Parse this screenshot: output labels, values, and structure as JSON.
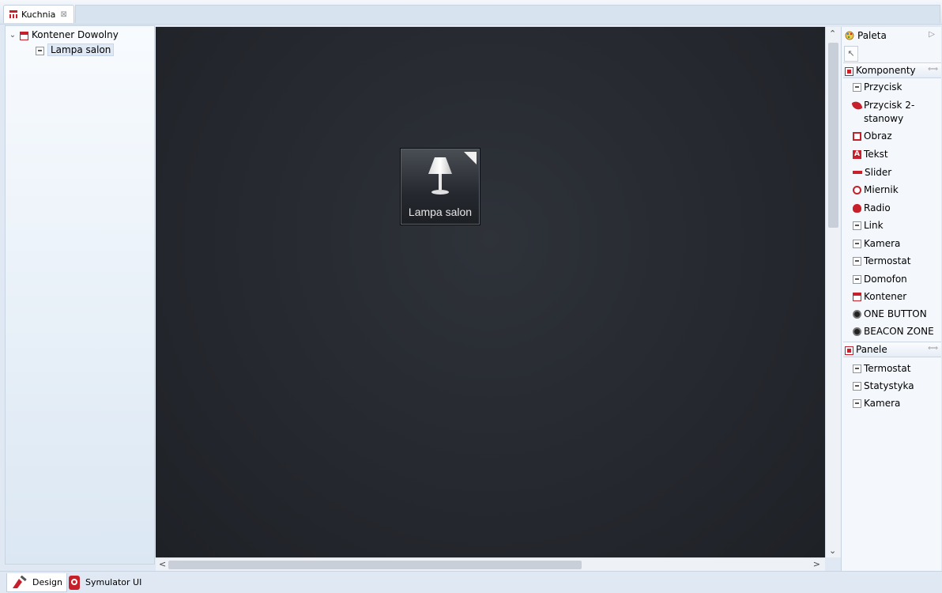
{
  "editor_tab": {
    "title": "Kuchnia",
    "close_glyph": "⊠",
    "icon": "layout-icon"
  },
  "outline": {
    "root": {
      "label": "Kontener Dowolny",
      "expanded": true,
      "icon": "container-icon"
    },
    "child": {
      "label": "Lampa salon",
      "icon": "component-icon"
    }
  },
  "canvas": {
    "widget": {
      "label": "Lampa salon",
      "icon": "lamp-icon"
    }
  },
  "palette": {
    "title": "Paleta",
    "drawers": [
      {
        "label": "Komponenty",
        "items": [
          {
            "label": "Przycisk",
            "icon": "default-icon"
          },
          {
            "label": "Przycisk 2-",
            "label2": "stanowy",
            "icon": "toggle-icon"
          },
          {
            "label": "Obraz",
            "icon": "image-icon"
          },
          {
            "label": "Tekst",
            "icon": "text-icon"
          },
          {
            "label": "Slider",
            "icon": "slider-icon"
          },
          {
            "label": "Miernik",
            "icon": "gauge-icon"
          },
          {
            "label": "Radio",
            "icon": "radio-icon"
          },
          {
            "label": "Link",
            "icon": "default-icon"
          },
          {
            "label": "Kamera",
            "icon": "default-icon"
          },
          {
            "label": "Termostat",
            "icon": "default-icon"
          },
          {
            "label": "Domofon",
            "icon": "default-icon"
          },
          {
            "label": "Kontener",
            "icon": "container-icon"
          },
          {
            "label": "ONE BUTTON",
            "icon": "dot-icon"
          },
          {
            "label": "BEACON ZONE",
            "icon": "dot-icon"
          }
        ]
      },
      {
        "label": "Panele",
        "items": [
          {
            "label": "Termostat",
            "icon": "default-icon"
          },
          {
            "label": "Statystyka",
            "icon": "default-icon"
          },
          {
            "label": "Kamera",
            "icon": "default-icon"
          }
        ]
      }
    ]
  },
  "bottom_tabs": [
    {
      "label": "Design",
      "active": true
    },
    {
      "label": "Symulator UI",
      "active": false
    }
  ],
  "colors": {
    "accent": "#c8202a",
    "canvas": "#26292f"
  }
}
